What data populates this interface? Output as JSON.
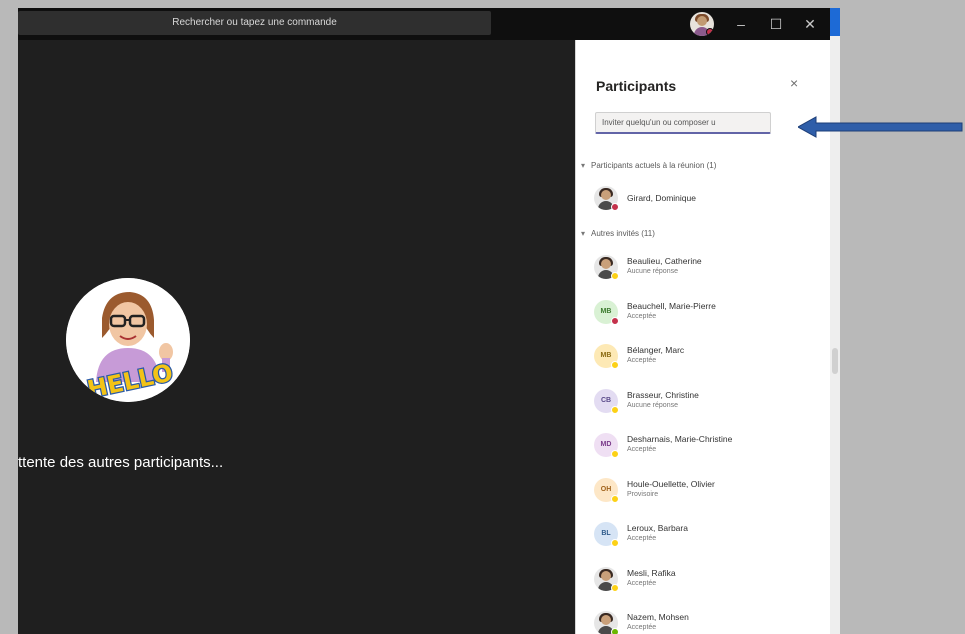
{
  "titlebar": {
    "search_placeholder": "Rechercher ou tapez une commande"
  },
  "stage": {
    "waiting_text": "ttente des autres participants..."
  },
  "panel": {
    "title": "Participants",
    "close_glyph": "×",
    "invite_placeholder": "Inviter quelqu'un ou composer u",
    "current_section": "Participants actuels à la réunion (1)",
    "current": [
      {
        "name": "Girard, Dominique",
        "avatar_type": "photo",
        "presence": "busy"
      }
    ],
    "others_section": "Autres invités (11)",
    "others": [
      {
        "name": "Beaulieu, Catherine",
        "status": "Aucune réponse",
        "avatar_type": "photo",
        "presence": "away"
      },
      {
        "name": "Beauchell, Marie-Pierre",
        "status": "Acceptée",
        "initials": "MB",
        "bg": "#d9f1d4",
        "fg": "#3b7a2d",
        "presence": "busy"
      },
      {
        "name": "Bélanger, Marc",
        "status": "Acceptée",
        "initials": "MB",
        "bg": "#fde9b5",
        "fg": "#8a6a10",
        "presence": "away"
      },
      {
        "name": "Brasseur, Christine",
        "status": "Aucune réponse",
        "initials": "CB",
        "bg": "#e3dcf2",
        "fg": "#5a4a8a",
        "presence": "away"
      },
      {
        "name": "Desharnais, Marie-Christine",
        "status": "Acceptée",
        "initials": "MD",
        "bg": "#efdff3",
        "fg": "#7a3a8a",
        "presence": "away"
      },
      {
        "name": "Houle-Ouellette, Olivier",
        "status": "Provisoire",
        "initials": "OH",
        "bg": "#fde7c7",
        "fg": "#a0621a",
        "presence": "away"
      },
      {
        "name": "Leroux, Barbara",
        "status": "Acceptée",
        "initials": "BL",
        "bg": "#d6e4f5",
        "fg": "#2e5a8a",
        "presence": "away"
      },
      {
        "name": "Mesli, Rafika",
        "status": "Acceptée",
        "avatar_type": "photo",
        "presence": "away"
      },
      {
        "name": "Nazem, Mohsen",
        "status": "Acceptée",
        "avatar_type": "photo",
        "presence": "green"
      }
    ]
  },
  "window_controls": {
    "minimize": "–",
    "maximize": "☐",
    "close": "✕"
  },
  "colors": {
    "accent": "#6264a7",
    "arrow": "#2f5ea9",
    "busy": "#c4314b",
    "away": "#fcd116"
  }
}
